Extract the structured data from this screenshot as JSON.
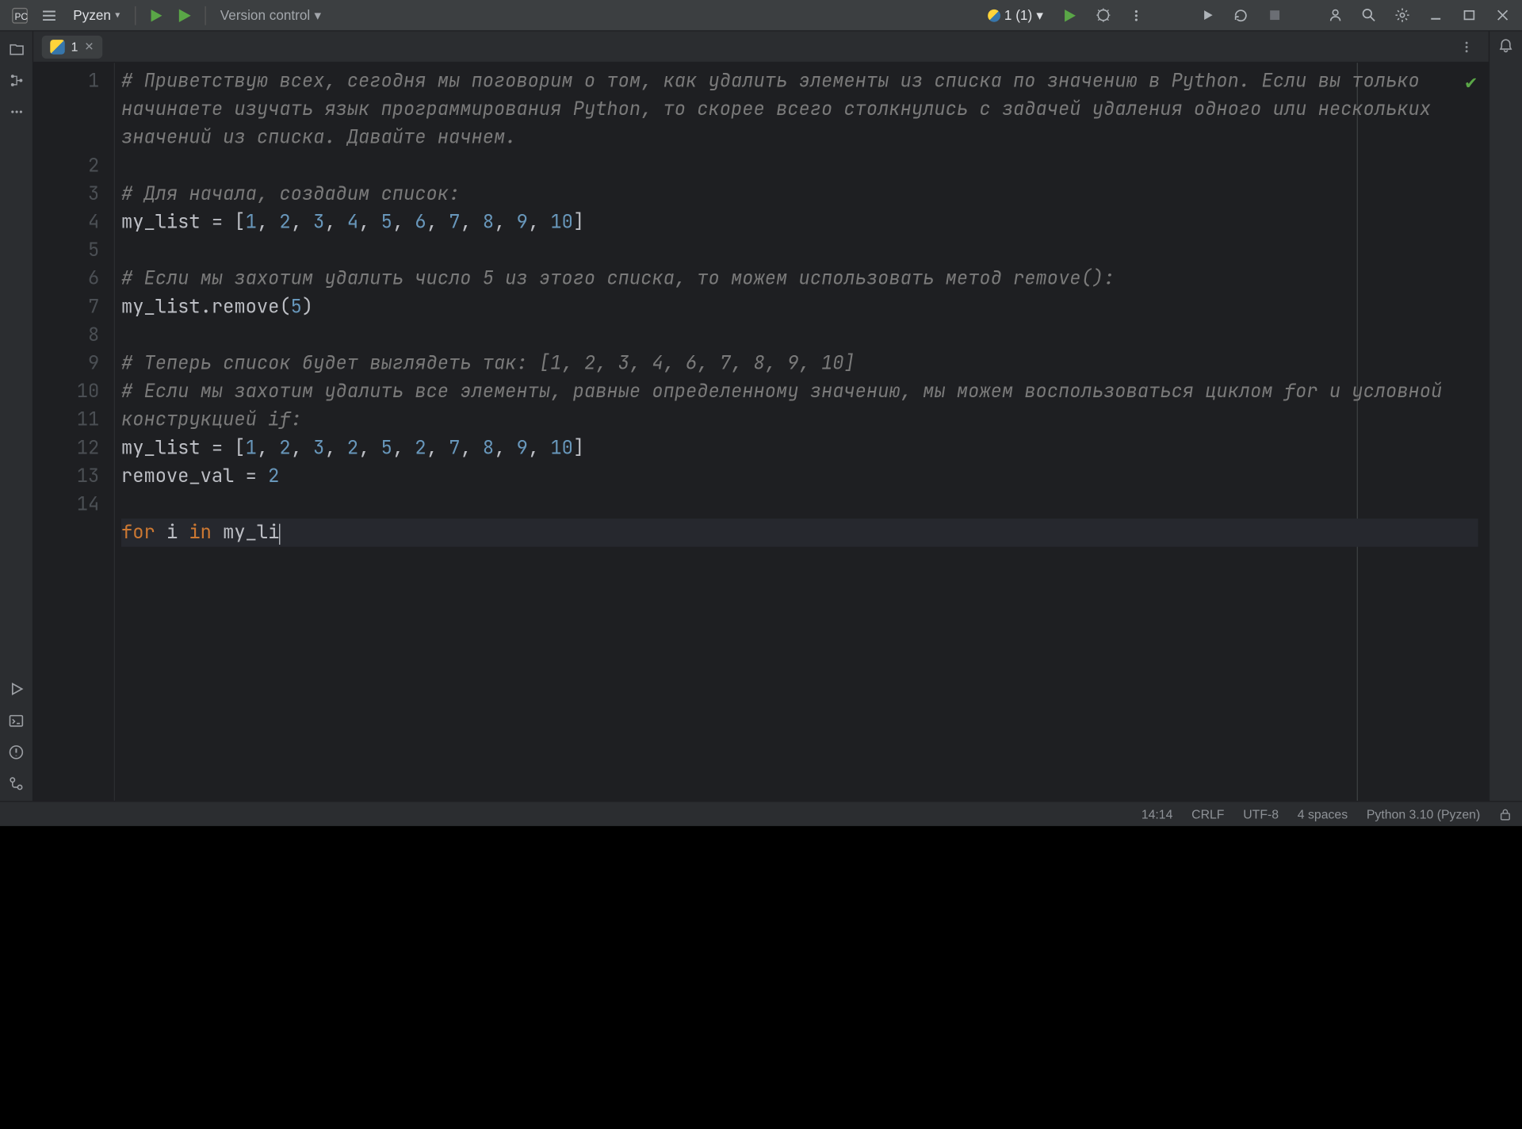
{
  "topbar": {
    "project": "Pyzen",
    "version_control": "Version control",
    "ai_indicator": "1 (1)"
  },
  "tab": {
    "label": "1"
  },
  "code": {
    "l1": "# Приветствую всех, сегодня мы поговорим о том, как удалить элементы из списка по значению в Python. Если вы только начинаете изучать язык программирования Python, то скорее всего столкнулись с задачей удаления одного или нескольких значений из списка. Давайте начнем.",
    "l3": "# Для начала, создадим список:",
    "l4_a": "my_list = [",
    "l4_nums": [
      "1",
      "2",
      "3",
      "4",
      "5",
      "6",
      "7",
      "8",
      "9",
      "10"
    ],
    "l4_b": "]",
    "l6": "# Если мы захотим удалить число 5 из этого списка, то можем использовать метод remove():",
    "l7_a": "my_list.remove(",
    "l7_n": "5",
    "l7_b": ")",
    "l9": "# Теперь список будет выглядеть так: [1, 2, 3, 4, 6, 7, 8, 9, 10]",
    "l10": "# Если мы захотим удалить все элементы, равные определенному значению, мы можем воспользоваться циклом for и условной конструкцией if:",
    "l11_a": "my_list = [",
    "l11_nums": [
      "1",
      "2",
      "3",
      "2",
      "5",
      "2",
      "7",
      "8",
      "9",
      "10"
    ],
    "l11_b": "]",
    "l12_a": "remove_val = ",
    "l12_n": "2",
    "l14_for": "for",
    "l14_i": " i ",
    "l14_in": "in",
    "l14_rest": " my_li"
  },
  "line_numbers": [
    "1",
    "2",
    "3",
    "4",
    "5",
    "6",
    "7",
    "8",
    "9",
    "10",
    "11",
    "12",
    "13",
    "14"
  ],
  "statusbar": {
    "pos": "14:14",
    "eol": "CRLF",
    "enc": "UTF-8",
    "indent": "4 spaces",
    "interp": "Python 3.10 (Pyzen)"
  }
}
